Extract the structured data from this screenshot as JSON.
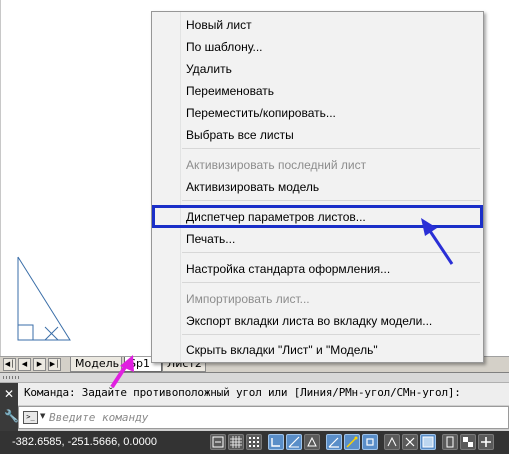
{
  "context_menu": {
    "items": [
      {
        "label": "Новый лист",
        "disabled": false
      },
      {
        "label": "По шаблону...",
        "disabled": false
      },
      {
        "label": "Удалить",
        "disabled": false
      },
      {
        "label": "Переименовать",
        "disabled": false
      },
      {
        "label": "Переместить/копировать...",
        "disabled": false
      },
      {
        "label": "Выбрать все листы",
        "disabled": false
      },
      {
        "label": "Активизировать последний лист",
        "disabled": true
      },
      {
        "label": "Активизировать модель",
        "disabled": false
      },
      {
        "label": "Диспетчер параметров листов...",
        "disabled": false,
        "highlighted": true
      },
      {
        "label": "Печать...",
        "disabled": false
      },
      {
        "label": "Настройка стандарта оформления...",
        "disabled": false
      },
      {
        "label": "Импортировать лист...",
        "disabled": true
      },
      {
        "label": "Экспорт вкладки листа во вкладку модели...",
        "disabled": false
      },
      {
        "label": "Скрыть вкладки \"Лист\" и \"Модель\"",
        "disabled": false
      }
    ],
    "highlight_color": "#1a2fc8"
  },
  "layout_tabs": {
    "model": "Модель",
    "active": "Sp1",
    "other": "Лист2"
  },
  "command_line": {
    "history": "Команда: Задайте противоположный угол или [Линия/РМн-угол/СМн-угол]:",
    "placeholder": "Введите команду"
  },
  "status_bar": {
    "coordinates": "-382.6585, -251.5666, 0.0000"
  },
  "icons": {
    "close": "close-icon",
    "wrench": "wrench-icon",
    "prompt": "command-prompt-icon"
  },
  "annotation_colors": {
    "blue_arrow": "#2a2fd6",
    "magenta_arrow": "#e020e0"
  }
}
